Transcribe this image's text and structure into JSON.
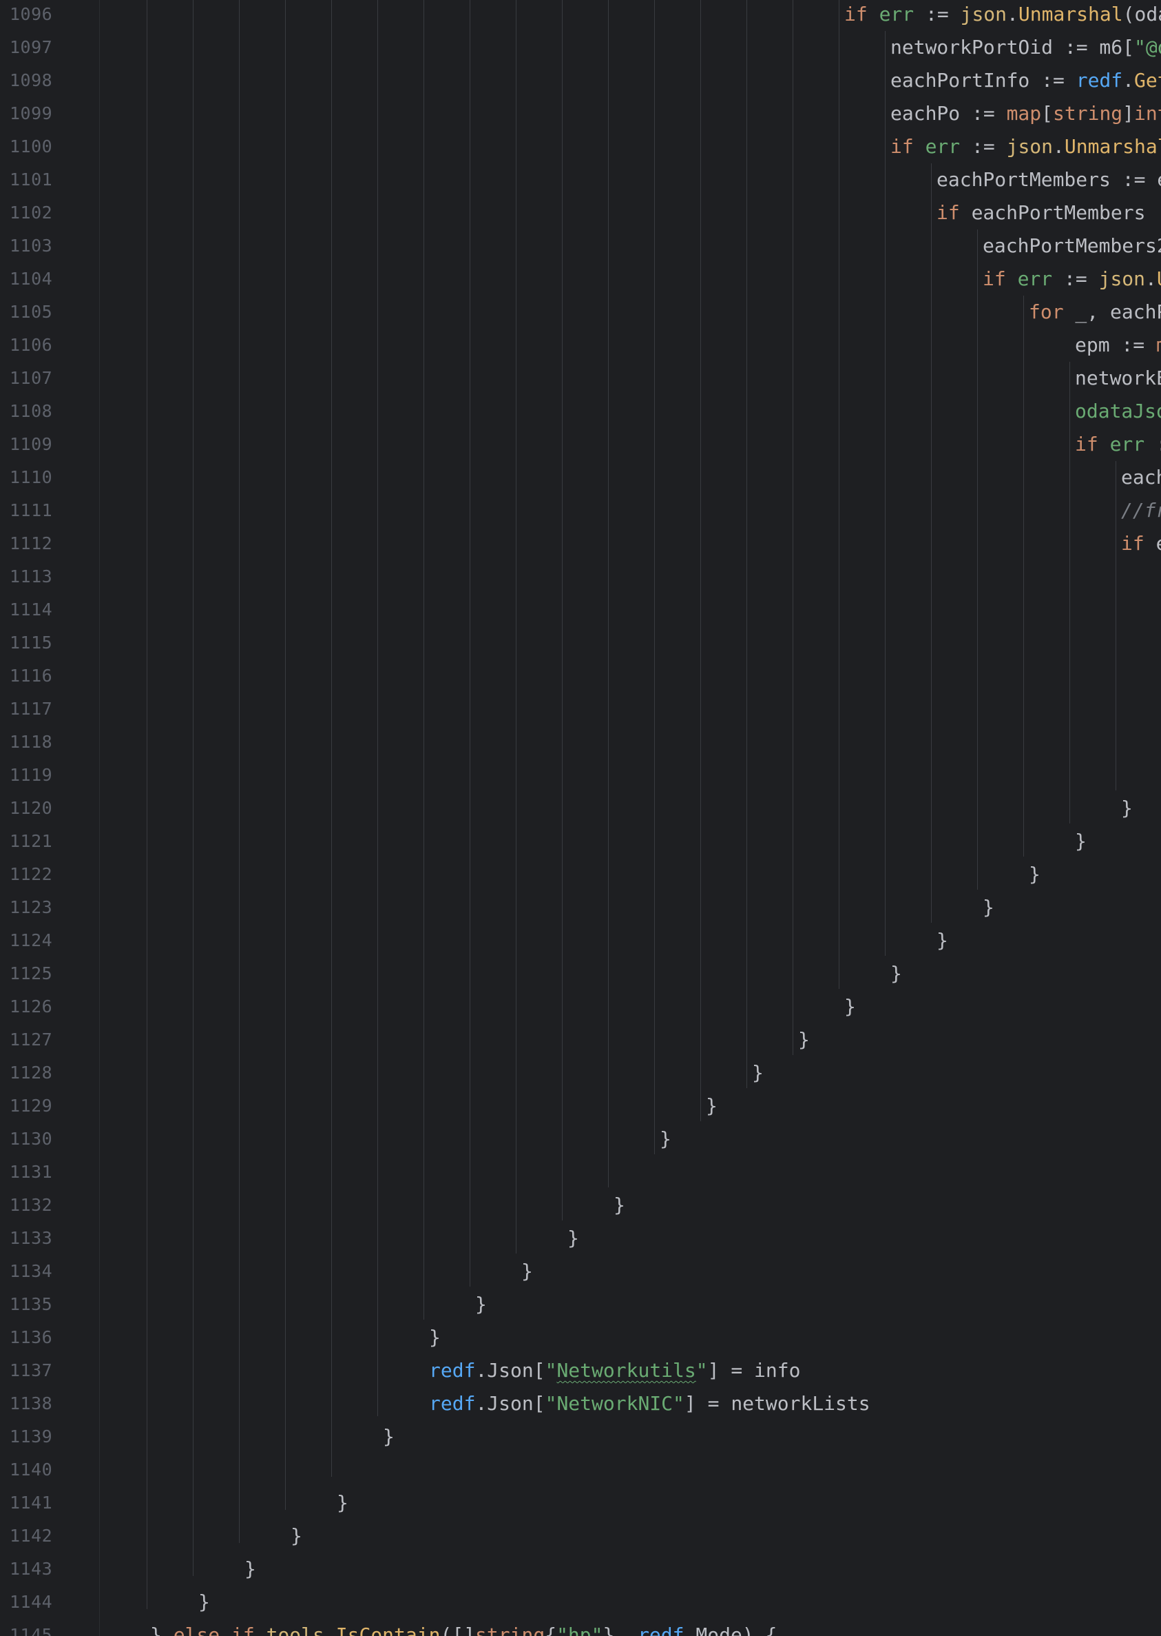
{
  "editor": {
    "line_numbers": [
      "1096",
      "1097",
      "1098",
      "1099",
      "1100",
      "1101",
      "1102",
      "1103",
      "1104",
      "1105",
      "1106",
      "1107",
      "1108",
      "1109",
      "1110",
      "1111",
      "1112",
      "1113",
      "1114",
      "1115",
      "1116",
      "1117",
      "1118",
      "1119",
      "1120",
      "1121",
      "1122",
      "1123",
      "1124",
      "1125",
      "1126",
      "1127",
      "1128",
      "1129",
      "1130",
      "1131",
      "1132",
      "1133",
      "1134",
      "1135",
      "1136",
      "1137",
      "1138",
      "1139",
      "1140",
      "1141",
      "1142",
      "1143",
      "1144",
      "1145"
    ],
    "lines": [
      {
        "tokens": [
          {
            "t": "if",
            "c": "kw"
          },
          {
            "t": " "
          },
          {
            "t": "err",
            "c": "err"
          },
          {
            "t": " := "
          },
          {
            "t": "json",
            "c": "pkg"
          },
          {
            "t": "."
          },
          {
            "t": "Unmarshal",
            "c": "meth"
          },
          {
            "t": "(oda"
          }
        ]
      },
      {
        "tokens": [
          {
            "t": "networkPortOid := m6["
          },
          {
            "t": "\"@o",
            "c": "str"
          }
        ]
      },
      {
        "tokens": [
          {
            "t": "eachPortInfo := "
          },
          {
            "t": "redf",
            "c": "redf"
          },
          {
            "t": "."
          },
          {
            "t": "Get",
            "c": "meth"
          }
        ]
      },
      {
        "tokens": [
          {
            "t": "eachPo := "
          },
          {
            "t": "map",
            "c": "kw"
          },
          {
            "t": "["
          },
          {
            "t": "string",
            "c": "type"
          },
          {
            "t": "]"
          },
          {
            "t": "int",
            "c": "type"
          }
        ]
      },
      {
        "tokens": [
          {
            "t": "if",
            "c": "kw"
          },
          {
            "t": " "
          },
          {
            "t": "err",
            "c": "err"
          },
          {
            "t": " := "
          },
          {
            "t": "json",
            "c": "pkg"
          },
          {
            "t": "."
          },
          {
            "t": "Unmarshal",
            "c": "meth"
          }
        ]
      },
      {
        "tokens": [
          {
            "t": "eachPortMembers := e"
          }
        ]
      },
      {
        "tokens": [
          {
            "t": "if",
            "c": "kw"
          },
          {
            "t": " eachPortMembers !"
          }
        ]
      },
      {
        "tokens": [
          {
            "t": "eachPortMembers2"
          }
        ]
      },
      {
        "tokens": [
          {
            "t": "if",
            "c": "kw"
          },
          {
            "t": " "
          },
          {
            "t": "err",
            "c": "err"
          },
          {
            "t": " := "
          },
          {
            "t": "json",
            "c": "pkg"
          },
          {
            "t": "."
          },
          {
            "t": "U",
            "c": "meth"
          }
        ]
      },
      {
        "tokens": [
          {
            "t": "for",
            "c": "kw"
          },
          {
            "t": " _, eachP"
          }
        ]
      },
      {
        "tokens": [
          {
            "t": "epm := "
          },
          {
            "t": "m",
            "c": "kw"
          }
        ]
      },
      {
        "tokens": [
          {
            "t": "networkE"
          }
        ]
      },
      {
        "tokens": [
          {
            "t": "odataJso",
            "c": "str"
          }
        ]
      },
      {
        "tokens": [
          {
            "t": "if",
            "c": "kw"
          },
          {
            "t": " "
          },
          {
            "t": "err",
            "c": "err"
          },
          {
            "t": " :"
          }
        ]
      },
      {
        "tokens": [
          {
            "t": "each"
          }
        ]
      },
      {
        "tokens": [
          {
            "t": "//fr",
            "c": "cmt"
          }
        ]
      },
      {
        "tokens": [
          {
            "t": "if",
            "c": "kw"
          },
          {
            "t": " e"
          }
        ]
      },
      {
        "tokens": []
      },
      {
        "tokens": []
      },
      {
        "tokens": []
      },
      {
        "tokens": []
      },
      {
        "tokens": []
      },
      {
        "tokens": []
      },
      {
        "tokens": []
      },
      {
        "tokens": [
          {
            "t": "}"
          }
        ]
      },
      {
        "tokens": [
          {
            "t": "}"
          }
        ]
      },
      {
        "tokens": [
          {
            "t": "}"
          }
        ]
      },
      {
        "tokens": [
          {
            "t": "}"
          }
        ]
      },
      {
        "tokens": [
          {
            "t": "}"
          }
        ]
      },
      {
        "tokens": [
          {
            "t": "}"
          }
        ]
      },
      {
        "tokens": [
          {
            "t": "}"
          }
        ]
      },
      {
        "tokens": [
          {
            "t": "}"
          }
        ]
      },
      {
        "tokens": [
          {
            "t": "}"
          }
        ]
      },
      {
        "tokens": [
          {
            "t": "}"
          }
        ]
      },
      {
        "tokens": [
          {
            "t": "}"
          }
        ]
      },
      {
        "tokens": []
      },
      {
        "tokens": [
          {
            "t": "}"
          }
        ]
      },
      {
        "tokens": [
          {
            "t": "}"
          }
        ]
      },
      {
        "tokens": [
          {
            "t": "}"
          }
        ]
      },
      {
        "tokens": [
          {
            "t": "}"
          }
        ]
      },
      {
        "tokens": [
          {
            "t": "}"
          }
        ]
      },
      {
        "tokens": [
          {
            "t": "redf",
            "c": "redf"
          },
          {
            "t": ".Json["
          },
          {
            "t": "\"",
            "c": "str"
          },
          {
            "t": "Networkutils",
            "c": "str typo"
          },
          {
            "t": "\"",
            "c": "str"
          },
          {
            "t": "] = info"
          }
        ]
      },
      {
        "tokens": [
          {
            "t": "redf",
            "c": "redf"
          },
          {
            "t": ".Json["
          },
          {
            "t": "\"NetworkNIC\"",
            "c": "str"
          },
          {
            "t": "] = networkLists"
          }
        ]
      },
      {
        "tokens": [
          {
            "t": "}"
          }
        ]
      },
      {
        "tokens": []
      },
      {
        "tokens": [
          {
            "t": "}"
          }
        ]
      },
      {
        "tokens": [
          {
            "t": "}"
          }
        ]
      },
      {
        "tokens": [
          {
            "t": "}"
          }
        ]
      },
      {
        "tokens": [
          {
            "t": "}"
          }
        ]
      },
      {
        "tokens": [
          {
            "t": "} "
          },
          {
            "t": "else",
            "c": "kw"
          },
          {
            "t": " "
          },
          {
            "t": "if",
            "c": "kw"
          },
          {
            "t": " "
          },
          {
            "t": "tools",
            "c": "pkg"
          },
          {
            "t": "."
          },
          {
            "t": "IsContain",
            "c": "meth"
          },
          {
            "t": "([]"
          },
          {
            "t": "string",
            "c": "type"
          },
          {
            "t": "{"
          },
          {
            "t": "\"hp\"",
            "c": "str"
          },
          {
            "t": "}, "
          },
          {
            "t": "redf",
            "c": "redf"
          },
          {
            "t": ".Mode) {"
          }
        ]
      }
    ]
  }
}
